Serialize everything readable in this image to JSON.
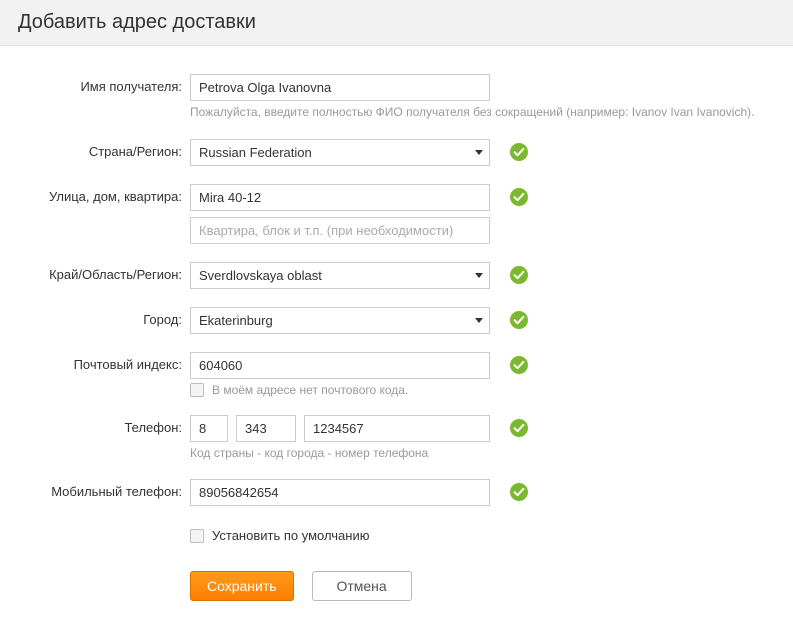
{
  "header": {
    "title": "Добавить адрес доставки"
  },
  "labels": {
    "name": "Имя получателя:",
    "country": "Страна/Регион:",
    "street": "Улица, дом, квартира:",
    "region": "Край/Область/Регион:",
    "city": "Город:",
    "zip": "Почтовый индекс:",
    "phone": "Телефон:",
    "mobile": "Мобильный телефон:"
  },
  "values": {
    "name": "Petrova Olga Ivanovna",
    "country": "Russian Federation",
    "street": "Mira 40-12",
    "apartment_placeholder": "Квартира, блок и т.п. (при необходимости)",
    "region": "Sverdlovskaya oblast",
    "city": "Ekaterinburg",
    "zip": "604060",
    "phone_cc": "8",
    "phone_ac": "343",
    "phone_num": "1234567",
    "mobile": "89056842654"
  },
  "hints": {
    "name": "Пожалуйста, введите полностью ФИО получателя без сокращений (например: Ivanov Ivan Ivanovich).",
    "no_zip": "В моём адресе нет почтового кода.",
    "phone": "Код страны - код города - номер телефона"
  },
  "checkbox": {
    "default_label": "Установить по умолчанию"
  },
  "buttons": {
    "save": "Сохранить",
    "cancel": "Отмена"
  }
}
